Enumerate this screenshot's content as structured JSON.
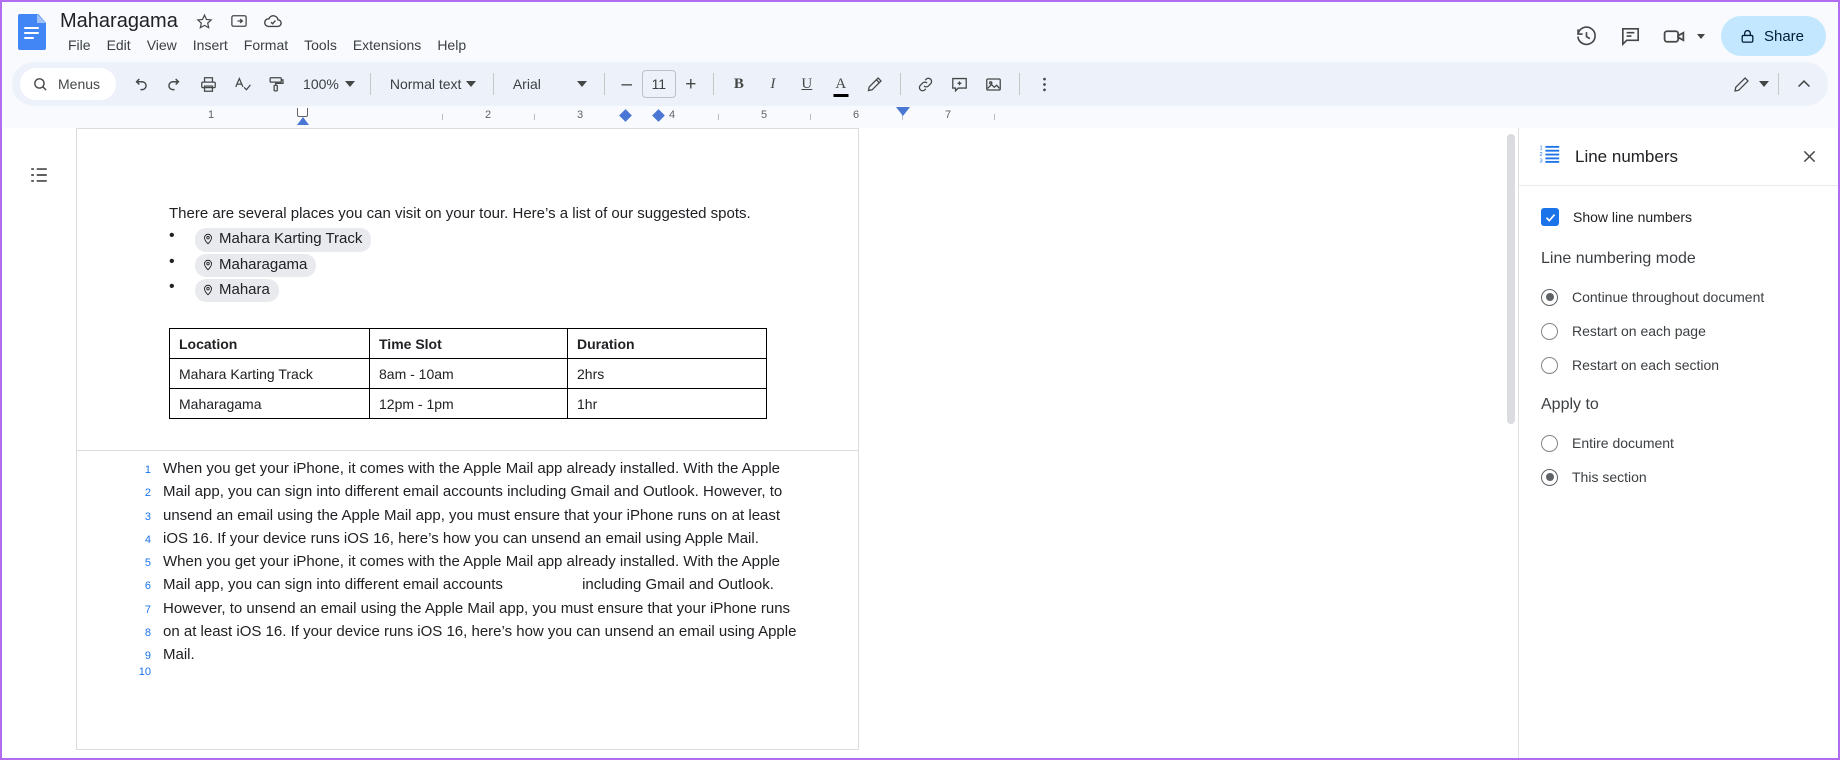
{
  "header": {
    "logo_icon": "google-docs-logo",
    "doc_title": "Maharagama",
    "star_icon": "star-icon",
    "move_icon": "move-to-folder-icon",
    "cloud_icon": "saved-to-drive-icon",
    "menus": [
      "File",
      "Edit",
      "View",
      "Insert",
      "Format",
      "Tools",
      "Extensions",
      "Help"
    ],
    "right_icons": [
      "version-history-icon",
      "comment-history-icon",
      "meet-icon"
    ],
    "share_label": "Share",
    "share_icon": "lock-icon",
    "share_bg": "#c2e7ff"
  },
  "toolbar": {
    "menus_label": "Menus",
    "search_icon": "search-icon",
    "undo_icon": "undo-icon",
    "redo_icon": "redo-icon",
    "print_icon": "print-icon",
    "spellcheck_icon": "spellcheck-icon",
    "paint_format_icon": "paint-format-icon",
    "zoom_value": "100%",
    "paragraph_style": "Normal text",
    "font_family": "Arial",
    "font_size": "11",
    "decrease_label": "–",
    "increase_label": "+",
    "bold_label": "B",
    "italic_label": "I",
    "underline_label": "U",
    "text_color_label": "A",
    "highlight_icon": "highlight-pen-icon",
    "link_icon": "insert-link-icon",
    "comment_icon": "add-comment-icon",
    "image_icon": "insert-image-icon",
    "more_icon": "more-options-icon",
    "editing_mode_icon": "edit-pencil-icon",
    "collapse_icon": "collapse-chevron-up-icon"
  },
  "ruler": {
    "numbers": [
      "1",
      "2",
      "3",
      "4",
      "5",
      "6",
      "7"
    ]
  },
  "outline": {
    "icon": "document-outline-icon"
  },
  "document": {
    "intro": "There are several places you can visit on your tour. Here’s a list of our suggested spots.",
    "chips": [
      {
        "icon": "location-pin-icon",
        "label": "Mahara Karting Track"
      },
      {
        "icon": "location-pin-icon",
        "label": "Maharagama"
      },
      {
        "icon": "location-pin-icon",
        "label": "Mahara"
      }
    ],
    "table": {
      "headers": [
        "Location",
        "Time Slot",
        "Duration"
      ],
      "rows": [
        [
          "Mahara Karting Track",
          "8am - 10am",
          "2hrs"
        ],
        [
          "Maharagama",
          "12pm - 1pm",
          "1hr"
        ]
      ]
    },
    "numbered_lines": [
      {
        "n": "1",
        "text": "When you get your iPhone, it comes with the Apple Mail app already installed. With the Apple"
      },
      {
        "n": "2",
        "text": "Mail app, you can sign into different email accounts including Gmail and Outlook. However, to"
      },
      {
        "n": "3",
        "text": "unsend an email using the Apple Mail app, you must ensure that your iPhone runs on at least"
      },
      {
        "n": "4",
        "text": "iOS 16. If your device runs iOS 16, here’s how you can unsend an email using Apple Mail."
      },
      {
        "n": "5",
        "text": "When you get your iPhone, it comes with the Apple Mail app already installed. With the Apple"
      },
      {
        "n": "6",
        "text": "Mail app, you can sign into different email accounts                   including Gmail and Outlook."
      },
      {
        "n": "7",
        "text": "However, to unsend an email using the Apple Mail app, you must ensure that your iPhone runs"
      },
      {
        "n": "8",
        "text": "on at least iOS 16. If your device runs iOS 16, here’s how you can unsend an email using Apple"
      },
      {
        "n": "9",
        "text": "Mail."
      },
      {
        "n": "10",
        "text": ""
      }
    ],
    "line_number_color": "#1a73e8"
  },
  "sidebar": {
    "icon": "line-numbers-icon",
    "title": "Line numbers",
    "close_icon": "close-icon",
    "show_line_numbers_label": "Show line numbers",
    "show_line_numbers_checked": true,
    "mode_heading": "Line numbering mode",
    "mode_options": [
      {
        "label": "Continue throughout document",
        "selected": true
      },
      {
        "label": "Restart on each page",
        "selected": false
      },
      {
        "label": "Restart on each section",
        "selected": false
      }
    ],
    "apply_heading": "Apply to",
    "apply_options": [
      {
        "label": "Entire document",
        "selected": false
      },
      {
        "label": "This section",
        "selected": true
      }
    ],
    "accent_color": "#1a73e8"
  }
}
